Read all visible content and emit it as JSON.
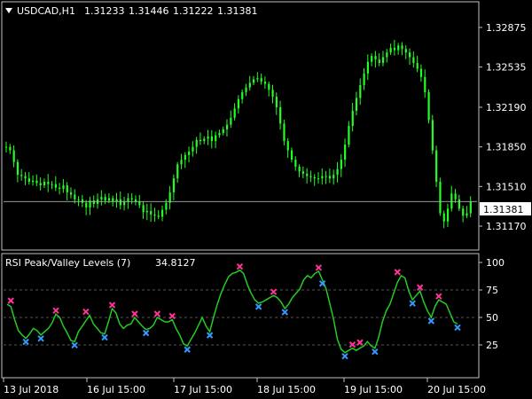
{
  "symbol": "USDCAD,H1",
  "ohlc": [
    "1.31233",
    "1.31446",
    "1.31222",
    "1.31381"
  ],
  "current_price": "1.31381",
  "indicator": {
    "name": "RSI Peak/Valley Levels (7)",
    "value": "34.8127"
  },
  "colors": {
    "bg": "#000000",
    "candle": "#22ff22",
    "rsi_line": "#22cc22",
    "peak": "#ff3399",
    "valley": "#3399ff",
    "frame": "#c0c0c0",
    "grid": "#555555"
  },
  "chart_data": [
    {
      "type": "candlestick",
      "title": "USDCAD,H1",
      "ylim": [
        1.3098,
        1.3308
      ],
      "y_ticks": [
        "1.32875",
        "1.32535",
        "1.32190",
        "1.31850",
        "1.31510",
        "1.31170"
      ],
      "y_tick_values": [
        1.32875,
        1.32535,
        1.3219,
        1.3185,
        1.3151,
        1.3117
      ],
      "close_path": [
        1.3185,
        1.3182,
        1.3172,
        1.3161,
        1.316,
        1.3158,
        1.3155,
        1.3156,
        1.3154,
        1.3152,
        1.3155,
        1.3153,
        1.3153,
        1.315,
        1.3149,
        1.3152,
        1.3146,
        1.3144,
        1.314,
        1.314,
        1.3137,
        1.3133,
        1.3139,
        1.3136,
        1.314,
        1.3142,
        1.3139,
        1.3141,
        1.3138,
        1.314,
        1.3135,
        1.3138,
        1.3141,
        1.314,
        1.3138,
        1.3135,
        1.3129,
        1.313,
        1.3127,
        1.3126,
        1.3125,
        1.3131,
        1.3137,
        1.3146,
        1.3158,
        1.317,
        1.3174,
        1.3178,
        1.3181,
        1.3185,
        1.3191,
        1.319,
        1.3192,
        1.3194,
        1.319,
        1.3195,
        1.3197,
        1.32,
        1.3204,
        1.321,
        1.3218,
        1.3226,
        1.3232,
        1.3236,
        1.324,
        1.3243,
        1.3244,
        1.3241,
        1.3239,
        1.3234,
        1.3228,
        1.3219,
        1.3205,
        1.319,
        1.3182,
        1.3174,
        1.3168,
        1.3164,
        1.3162,
        1.316,
        1.3159,
        1.3158,
        1.3158,
        1.316,
        1.316,
        1.3158,
        1.3161,
        1.3166,
        1.3174,
        1.3187,
        1.3203,
        1.3216,
        1.3227,
        1.3238,
        1.3248,
        1.3258,
        1.3263,
        1.326,
        1.3257,
        1.3262,
        1.3266,
        1.327,
        1.3268,
        1.3272,
        1.3269,
        1.3266,
        1.3262,
        1.3257,
        1.3252,
        1.3245,
        1.3232,
        1.3208,
        1.3182,
        1.3155,
        1.3128,
        1.3121,
        1.3132,
        1.3145,
        1.314,
        1.3132,
        1.3126,
        1.3128,
        1.3138
      ],
      "last_price": 1.31381,
      "x_ticks": [
        "13 Jul 2018",
        "16 Jul 15:00",
        "17 Jul 15:00",
        "18 Jul 15:00",
        "19 Jul 15:00",
        "20 Jul 15:00"
      ]
    },
    {
      "type": "line",
      "title": "RSI Peak/Valley Levels (7) 34.8127",
      "ylim": [
        0,
        100
      ],
      "y_ticks": [
        "100",
        "75",
        "50",
        "25"
      ],
      "y_tick_values": [
        100,
        75,
        50,
        25
      ],
      "levels": [
        75,
        50,
        25
      ],
      "x": [
        1,
        2,
        3,
        4,
        5,
        6,
        7,
        8,
        9,
        10,
        11,
        12,
        13,
        14,
        15,
        16,
        17,
        18,
        19,
        20,
        21,
        22,
        23,
        24,
        25,
        26,
        27,
        28,
        29,
        30,
        31,
        32,
        33,
        34,
        35,
        36,
        37,
        38,
        39,
        40,
        41,
        42,
        43,
        44,
        45,
        46,
        47,
        48,
        49,
        50,
        51,
        52,
        53,
        54,
        55,
        56,
        57,
        58,
        59,
        60,
        61,
        62,
        63,
        64,
        65,
        66,
        67,
        68,
        69,
        70,
        71,
        72,
        73,
        74,
        75,
        76,
        77,
        78,
        79,
        80,
        81,
        82,
        83,
        84,
        85,
        86,
        87,
        88,
        89,
        90,
        91,
        92,
        93,
        94,
        95,
        96,
        97,
        98,
        99,
        100,
        101,
        102,
        103,
        104,
        105,
        106,
        107,
        108,
        109,
        110,
        111,
        112,
        113,
        114,
        115,
        116,
        117,
        118,
        119,
        120,
        121
      ],
      "y": [
        62,
        60,
        48,
        38,
        34,
        31,
        35,
        40,
        38,
        34,
        37,
        40,
        45,
        53,
        50,
        42,
        36,
        29,
        28,
        37,
        42,
        47,
        52,
        44,
        40,
        36,
        35,
        46,
        58,
        54,
        44,
        40,
        43,
        44,
        50,
        46,
        42,
        39,
        40,
        43,
        50,
        48,
        46,
        46,
        48,
        40,
        34,
        26,
        24,
        30,
        36,
        43,
        50,
        42,
        37,
        50,
        62,
        72,
        80,
        87,
        90,
        91,
        93,
        90,
        80,
        72,
        66,
        63,
        64,
        66,
        68,
        70,
        68,
        64,
        58,
        62,
        68,
        72,
        76,
        84,
        88,
        86,
        90,
        92,
        84,
        76,
        62,
        48,
        30,
        21,
        18,
        20,
        22,
        20,
        22,
        24,
        28,
        24,
        22,
        32,
        46,
        56,
        62,
        72,
        82,
        88,
        86,
        74,
        66,
        70,
        74,
        64,
        56,
        50,
        60,
        66,
        64,
        62,
        54,
        46,
        44
      ],
      "peaks": [
        {
          "x": 2,
          "y": 62
        },
        {
          "x": 14,
          "y": 53
        },
        {
          "x": 22,
          "y": 52
        },
        {
          "x": 29,
          "y": 58
        },
        {
          "x": 35,
          "y": 50
        },
        {
          "x": 41,
          "y": 50
        },
        {
          "x": 45,
          "y": 48
        },
        {
          "x": 63,
          "y": 93
        },
        {
          "x": 72,
          "y": 70
        },
        {
          "x": 84,
          "y": 92
        },
        {
          "x": 93,
          "y": 22
        },
        {
          "x": 95,
          "y": 24
        },
        {
          "x": 105,
          "y": 88
        },
        {
          "x": 111,
          "y": 74
        },
        {
          "x": 116,
          "y": 66
        }
      ],
      "valleys": [
        {
          "x": 6,
          "y": 31
        },
        {
          "x": 10,
          "y": 34
        },
        {
          "x": 19,
          "y": 28
        },
        {
          "x": 27,
          "y": 35
        },
        {
          "x": 38,
          "y": 39
        },
        {
          "x": 49,
          "y": 24
        },
        {
          "x": 55,
          "y": 37
        },
        {
          "x": 68,
          "y": 63
        },
        {
          "x": 75,
          "y": 58
        },
        {
          "x": 85,
          "y": 84
        },
        {
          "x": 91,
          "y": 18
        },
        {
          "x": 99,
          "y": 22
        },
        {
          "x": 109,
          "y": 66
        },
        {
          "x": 114,
          "y": 50
        },
        {
          "x": 121,
          "y": 44
        }
      ],
      "x_ticks": [
        "13 Jul 2018",
        "16 Jul 15:00",
        "17 Jul 15:00",
        "18 Jul 15:00",
        "19 Jul 15:00",
        "20 Jul 15:00"
      ]
    }
  ]
}
